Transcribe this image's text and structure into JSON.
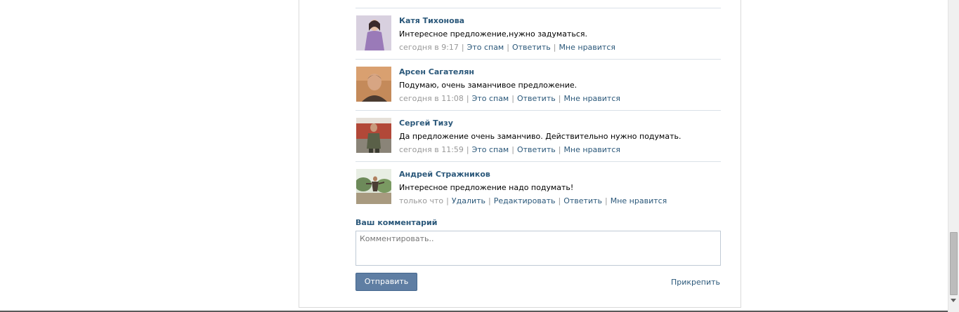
{
  "comments": [
    {
      "author": "Катя Тихонова",
      "text": "Интересное предложение,нужно задуматься.",
      "time": "сегодня в 9:17",
      "actions": [
        "Это спам",
        "Ответить",
        "Мне нравится"
      ],
      "avatar_color": "#9a7ab8"
    },
    {
      "author": "Арсен Сагателян",
      "text": "Подумаю, очень заманчивое предложение.",
      "time": "сегодня в 11:08",
      "actions": [
        "Это спам",
        "Ответить",
        "Мне нравится"
      ],
      "avatar_color": "#b07b4e"
    },
    {
      "author": "Сергей Тизу",
      "text": "Да предложение очень заманчиво. Действительно нужно подумать.",
      "time": "сегодня в 11:59",
      "actions": [
        "Это спам",
        "Ответить",
        "Мне нравится"
      ],
      "avatar_color": "#a85a4a"
    },
    {
      "author": "Андрей Стражников",
      "text": "Интересное предложение надо подумать!",
      "time": "только что",
      "actions": [
        "Удалить",
        "Редактировать",
        "Ответить",
        "Мне нравится"
      ],
      "avatar_color": "#6d8a5a"
    }
  ],
  "compose": {
    "label": "Ваш комментарий",
    "placeholder": "Комментировать..",
    "send_label": "Отправить",
    "attach_label": "Прикрепить"
  }
}
